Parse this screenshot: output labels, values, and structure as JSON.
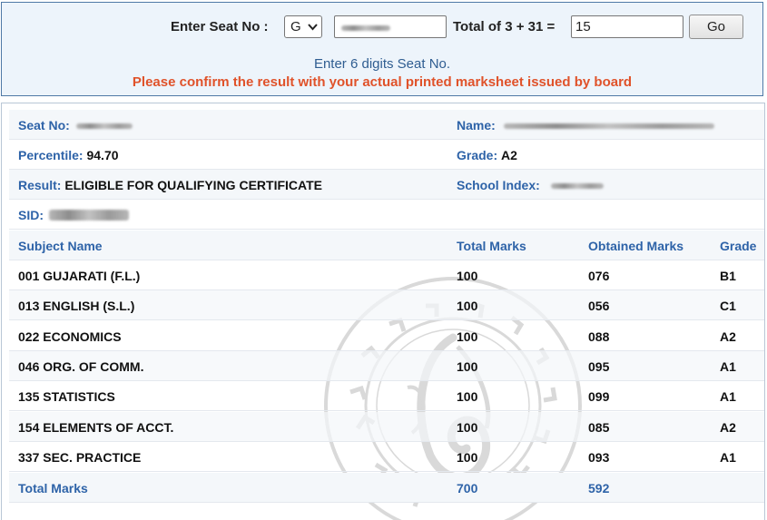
{
  "search": {
    "seat_label": "Enter Seat No :",
    "series_value": "G",
    "captcha_label": "Total of 3 + 31 =",
    "captcha_value": "15",
    "go_label": "Go",
    "hint": "Enter 6 digits Seat No.",
    "warning": "Please confirm the result with your actual printed marksheet issued by board"
  },
  "student": {
    "seat_label": "Seat No:",
    "name_label": "Name:",
    "percentile_label": "Percentile:",
    "percentile_value": "94.70",
    "grade_label": "Grade:",
    "grade_value": "A2",
    "result_label": "Result:",
    "result_value": "ELIGIBLE FOR QUALIFYING CERTIFICATE",
    "school_label": "School Index:",
    "sid_label": "SID:"
  },
  "table": {
    "headers": {
      "subject": "Subject Name",
      "total": "Total Marks",
      "obtained": "Obtained Marks",
      "grade": "Grade"
    },
    "rows": [
      {
        "subject": "001 GUJARATI (F.L.)",
        "total": "100",
        "obtained": "076",
        "grade": "B1"
      },
      {
        "subject": "013 ENGLISH (S.L.)",
        "total": "100",
        "obtained": "056",
        "grade": "C1"
      },
      {
        "subject": "022 ECONOMICS",
        "total": "100",
        "obtained": "088",
        "grade": "A2"
      },
      {
        "subject": "046 ORG. OF COMM.",
        "total": "100",
        "obtained": "095",
        "grade": "A1"
      },
      {
        "subject": "135 STATISTICS",
        "total": "100",
        "obtained": "099",
        "grade": "A1"
      },
      {
        "subject": "154 ELEMENTS OF ACCT.",
        "total": "100",
        "obtained": "085",
        "grade": "A2"
      },
      {
        "subject": "337 SEC. PRACTICE",
        "total": "100",
        "obtained": "093",
        "grade": "A1"
      }
    ],
    "footer": {
      "label": "Total Marks",
      "total": "700",
      "obtained": "592"
    }
  },
  "colors": {
    "accent": "#2e63a8",
    "warning": "#e0522a",
    "panel_bg": "#edf4fb"
  }
}
